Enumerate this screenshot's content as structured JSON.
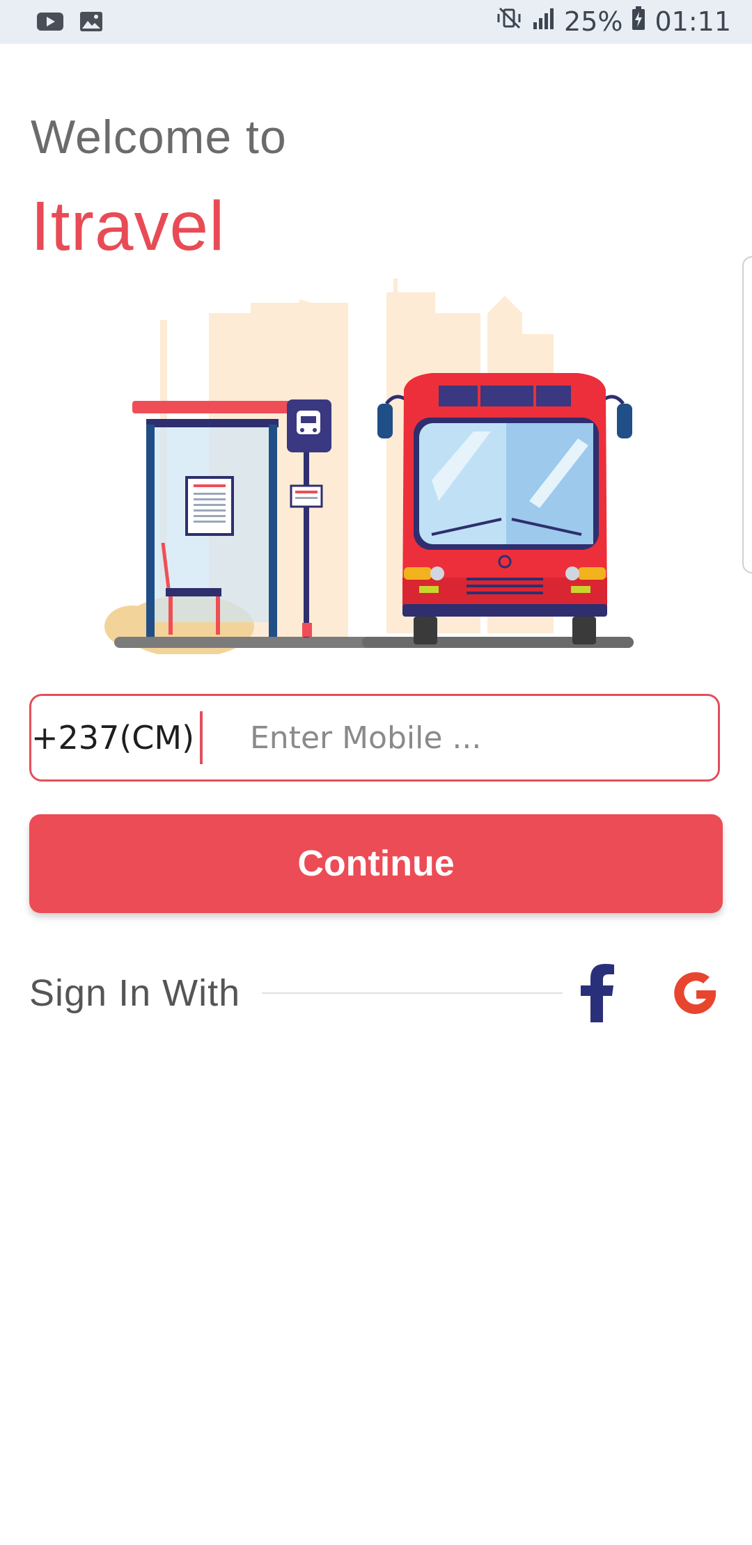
{
  "status_bar": {
    "left_icons": [
      "youtube-icon",
      "gallery-icon"
    ],
    "right_icons": [
      "mute-vibrate-icon",
      "signal-icon",
      "battery-icon"
    ],
    "battery": "25%",
    "time": "01:11"
  },
  "header": {
    "welcome": "Welcome to",
    "brand": "Itravel"
  },
  "illustration": {
    "icon": "bus-stop-illustration"
  },
  "phone_input": {
    "country_code": "+237(CM)",
    "placeholder": "Enter Mobile ...",
    "value": ""
  },
  "actions": {
    "continue_label": "Continue"
  },
  "social": {
    "label": "Sign In With",
    "providers": [
      "facebook-icon",
      "google-icon"
    ]
  },
  "colors": {
    "accent": "#ec4c56",
    "text_gray": "#6b6b6b",
    "facebook": "#2a2f7a",
    "google": "#e8452f"
  }
}
